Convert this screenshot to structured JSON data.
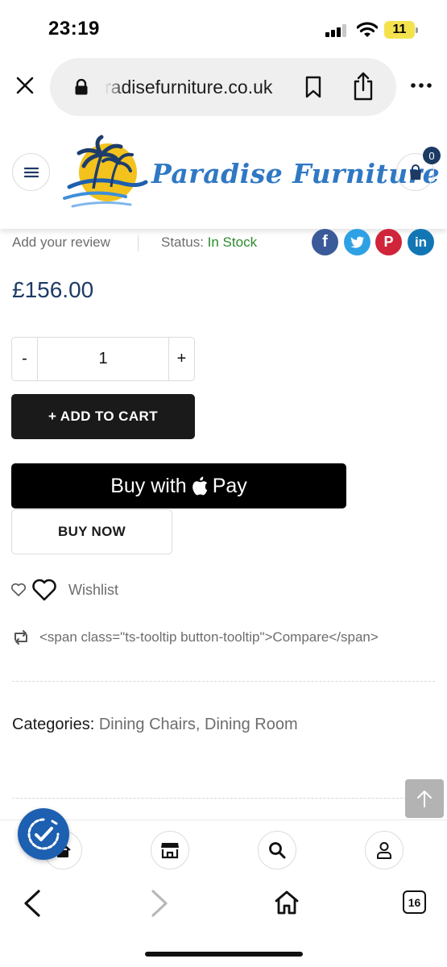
{
  "status_bar": {
    "time": "23:19",
    "battery_level": "11",
    "battery_color": "#f4e24d"
  },
  "browser": {
    "url": "radisefurniture.co.uk",
    "tab_count": "16"
  },
  "header": {
    "logo_text": "Paradise Furniture",
    "cart_count": "0",
    "brand_color": "#2f78c4"
  },
  "product": {
    "review_link": "Add your review",
    "status_label": "Status:",
    "status_value": "In Stock",
    "price": "£156.00",
    "quantity": "1",
    "qty_minus": "-",
    "qty_plus": "+",
    "add_to_cart": "+ ADD TO CART",
    "apple_pay_prefix": "Buy with",
    "apple_pay_word": "Pay",
    "buy_now": "BUY NOW",
    "wishlist": "Wishlist",
    "compare": "<span class=\"ts-tooltip button-tooltip\">Compare</span>",
    "categories_label": "Categories:",
    "categories_value": "Dining Chairs, Dining Room"
  },
  "social": {
    "facebook": "f",
    "twitter_color": "#2ea1e4",
    "pinterest": "P",
    "linkedin": "in"
  }
}
